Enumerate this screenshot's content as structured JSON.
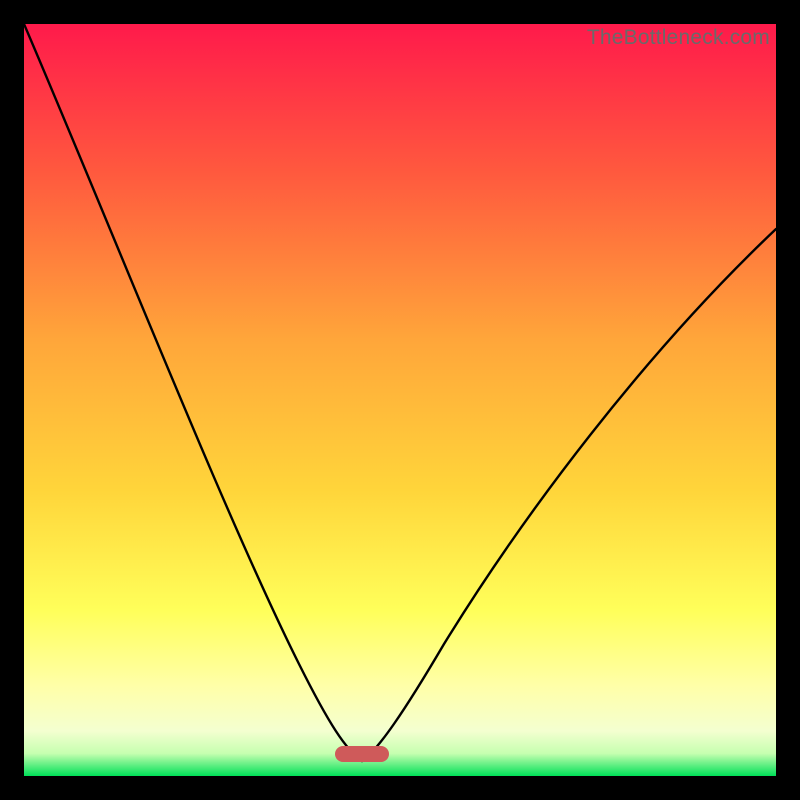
{
  "watermark": {
    "text": "TheBottleneck.com"
  },
  "chart_data": {
    "type": "line",
    "title": "",
    "xlabel": "",
    "ylabel": "",
    "xlim": [
      0,
      1
    ],
    "ylim": [
      0,
      1
    ],
    "grid": false,
    "legend": false,
    "gradient_colors": {
      "top": "#ff1a4b",
      "upper_mid": "#ff7a3a",
      "mid": "#ffd53a",
      "lower_mid": "#ffff7a",
      "near_bottom": "#eaffc0",
      "bottom": "#00e058"
    },
    "curve": {
      "minimum_x": 0.45,
      "minimum_y": 0.02,
      "left_endpoint": {
        "x": 0.0,
        "y": 1.0
      },
      "right_endpoint": {
        "x": 1.0,
        "y": 0.73
      },
      "description": "V-shaped curve: steep near-linear descent from top-left to a narrow minimum near x≈0.45, then a convex rise to roughly y≈0.73 at x=1."
    },
    "marker": {
      "shape": "rounded-bar",
      "center_x": 0.45,
      "y": 0.027,
      "width": 0.072,
      "height": 0.021,
      "fill": "#cf5a5a"
    }
  }
}
